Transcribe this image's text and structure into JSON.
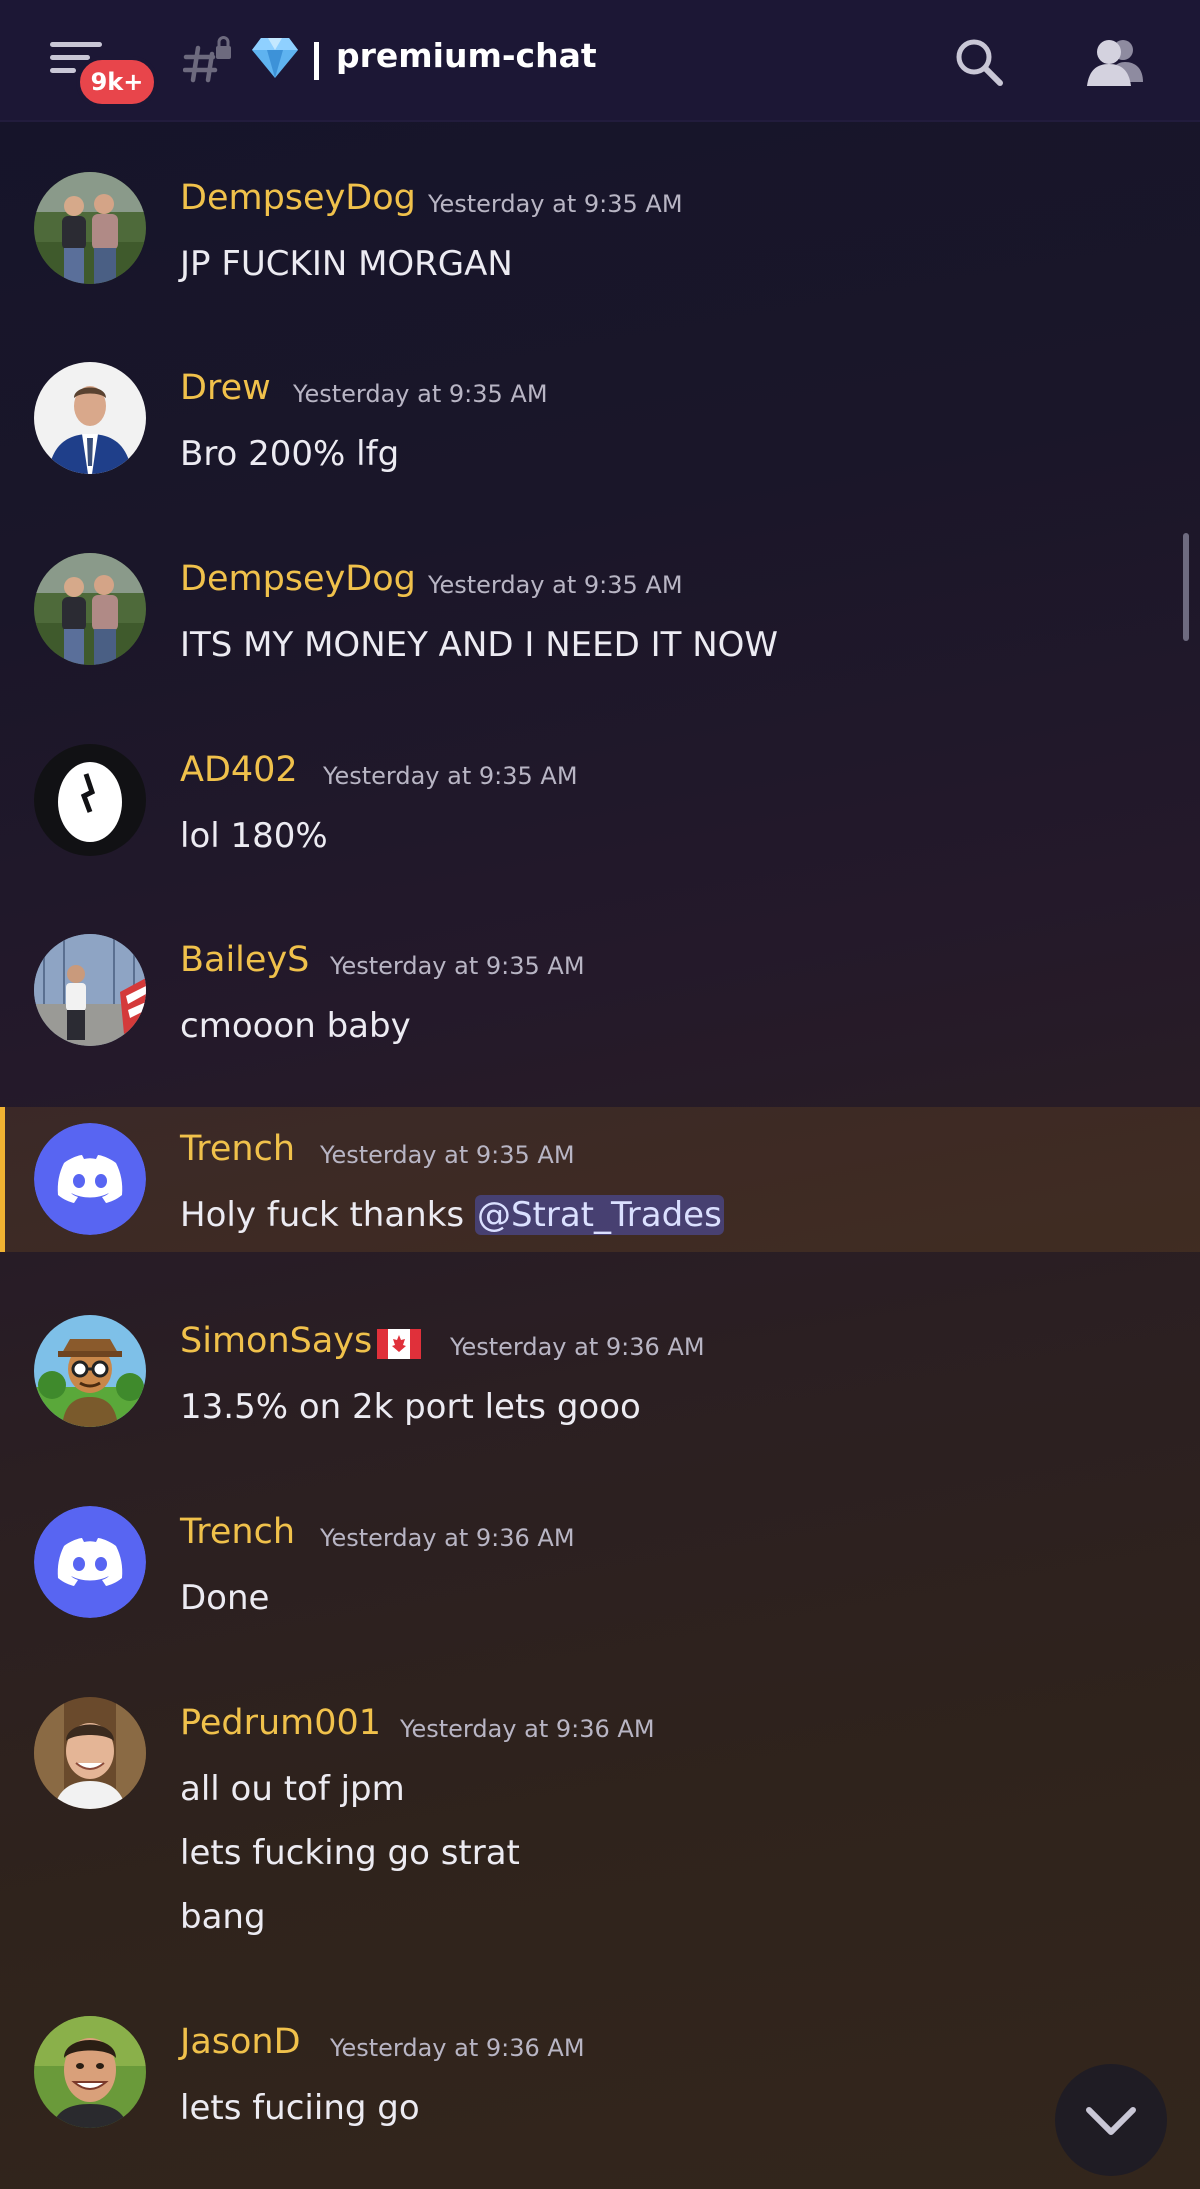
{
  "header": {
    "unread_badge": "9k+",
    "channel_name": "premium-chat",
    "icons": {
      "menu": "hamburger-menu-icon",
      "channel": "locked-text-channel-icon",
      "emoji": "gem-stone-emoji",
      "search": "search-icon",
      "members": "members-icon"
    }
  },
  "messages": [
    {
      "username": "DempseyDog",
      "timestamp": "Yesterday at 9:35 AM",
      "lines": [
        "JP FUCKIN MORGAN"
      ],
      "avatar": "two-men-photo"
    },
    {
      "username": "Drew",
      "timestamp": "Yesterday at 9:35 AM",
      "lines": [
        "Bro 200% lfg"
      ],
      "avatar": "man-in-suit-photo"
    },
    {
      "username": "DempseyDog",
      "timestamp": "Yesterday at 9:35 AM",
      "lines": [
        "ITS MY MONEY AND I NEED IT NOW"
      ],
      "avatar": "two-men-photo"
    },
    {
      "username": "AD402",
      "timestamp": "Yesterday at 9:35 AM",
      "lines": [
        "lol 180%"
      ],
      "avatar": "egg-logo"
    },
    {
      "username": "BaileyS",
      "timestamp": "Yesterday at 9:35 AM",
      "lines": [
        "cmooon baby"
      ],
      "avatar": "man-outdoors-photo"
    },
    {
      "username": "Trench",
      "timestamp": "Yesterday at 9:35 AM",
      "text_before_mention": "Holy fuck thanks ",
      "mention": "@Strat_Trades",
      "avatar": "discord-default-avatar",
      "highlighted": true
    },
    {
      "username": "SimonSays",
      "flag": "canada-flag",
      "timestamp": "Yesterday at 9:36 AM",
      "lines": [
        "13.5% on 2k port lets gooo"
      ],
      "avatar": "cartoon-character"
    },
    {
      "username": "Trench",
      "timestamp": "Yesterday at 9:36 AM",
      "lines": [
        "Done"
      ],
      "avatar": "discord-default-avatar"
    },
    {
      "username": "Pedrum001",
      "timestamp": "Yesterday at 9:36 AM",
      "lines": [
        "all ou tof jpm",
        "lets fucking go strat",
        "bang"
      ],
      "avatar": "smiling-man-photo"
    },
    {
      "username": "JasonD",
      "timestamp": "Yesterday at 9:36 AM",
      "lines": [
        "lets fuciing go"
      ],
      "avatar": "grinning-man-photo"
    }
  ],
  "colors": {
    "username": "#f0c14b",
    "accent": "#5865f2",
    "badge": "#e8454b",
    "highlight_bar": "#f0b232"
  },
  "jump_button": "chevron-down-icon"
}
